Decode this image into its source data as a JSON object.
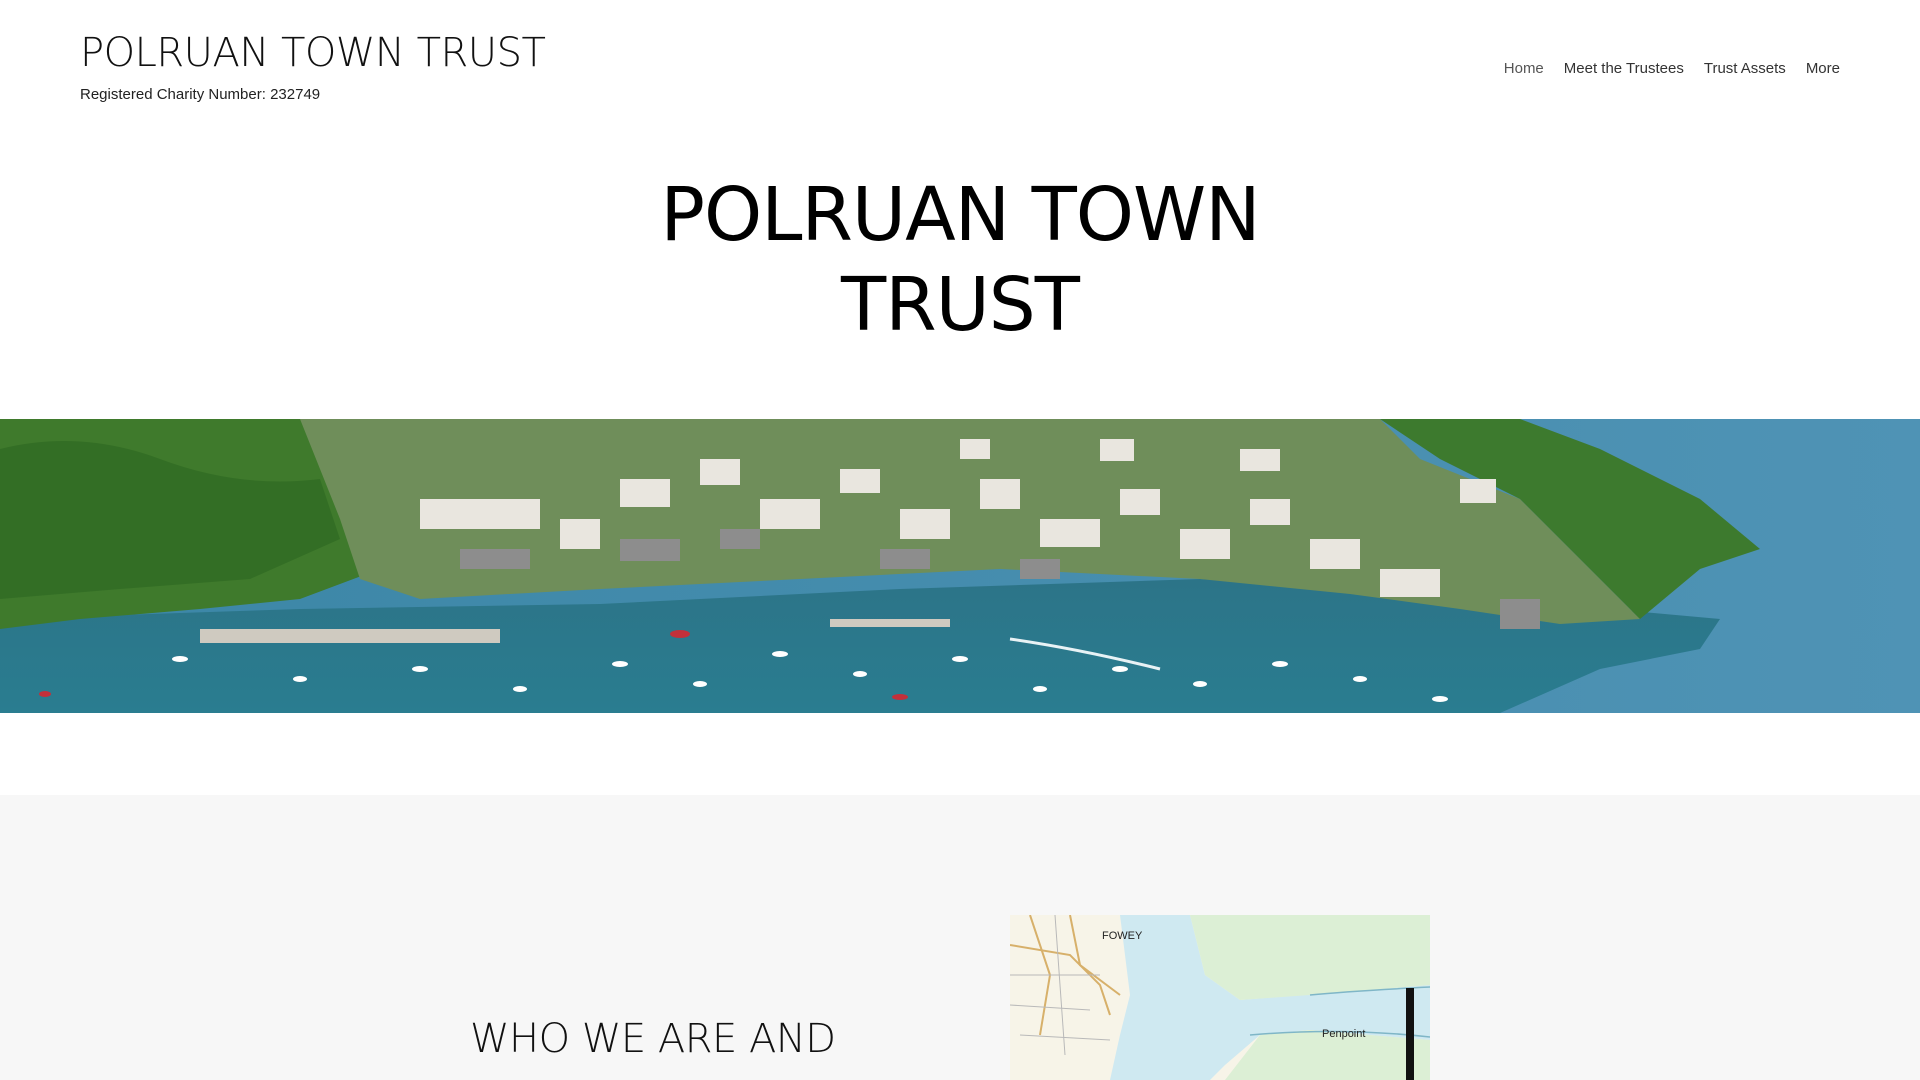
{
  "header": {
    "site_title": "POLRUAN TOWN TRUST",
    "charity_number": "Registered Charity Number: 232749"
  },
  "nav": {
    "items": [
      {
        "label": "Home"
      },
      {
        "label": "Meet the Trustees"
      },
      {
        "label": "Trust Assets"
      },
      {
        "label": "More"
      }
    ]
  },
  "hero": {
    "title_line1": "POLRUAN TOWN",
    "title_line2": "TRUST"
  },
  "banner": {
    "image_description": "aerial-harbour-photo"
  },
  "about": {
    "heading": "WHO WE ARE AND"
  },
  "map": {
    "labels": {
      "town": "FOWEY",
      "place": "Penpoint"
    }
  },
  "colors": {
    "sea": "#2f7f92",
    "foliage": "#3f7a2c",
    "section_bg": "#f7f7f7"
  }
}
